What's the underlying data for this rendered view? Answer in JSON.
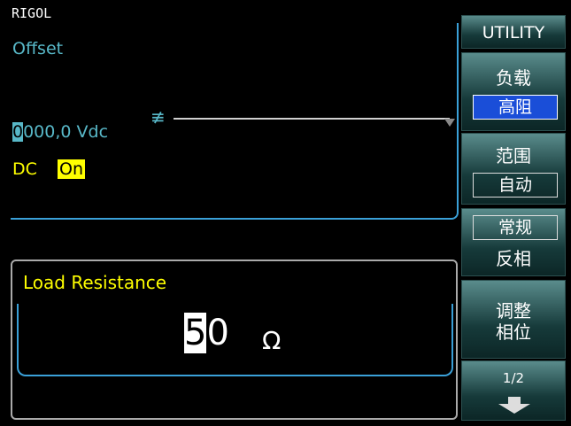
{
  "brand": "RIGOL",
  "top_panel": {
    "title": "Offset",
    "value_cursor_digit": "0",
    "value_rest": "000,0 Vdc",
    "dc_label": "DC",
    "dc_state": "On",
    "level_icon": "≢"
  },
  "dialog": {
    "title": "Load Resistance",
    "value_cursor_digit": "5",
    "value_rest": "0",
    "unit": "Ω"
  },
  "softkeys": {
    "utility": "UTILITY",
    "load": {
      "label": "负载",
      "option": "高阻"
    },
    "range": {
      "label": "范围",
      "option": "自动"
    },
    "phase": {
      "option": "常规",
      "label": "反相"
    },
    "adjust": {
      "line1": "调整",
      "line2": "相位"
    },
    "page": {
      "label": "1/2",
      "icon": "arrow-down-icon"
    }
  },
  "colors": {
    "accent_cyan": "#58b8c8",
    "highlight_yellow": "#ffff00",
    "selected_blue": "#1a4ed8",
    "frame_blue": "#3aa0d8"
  }
}
